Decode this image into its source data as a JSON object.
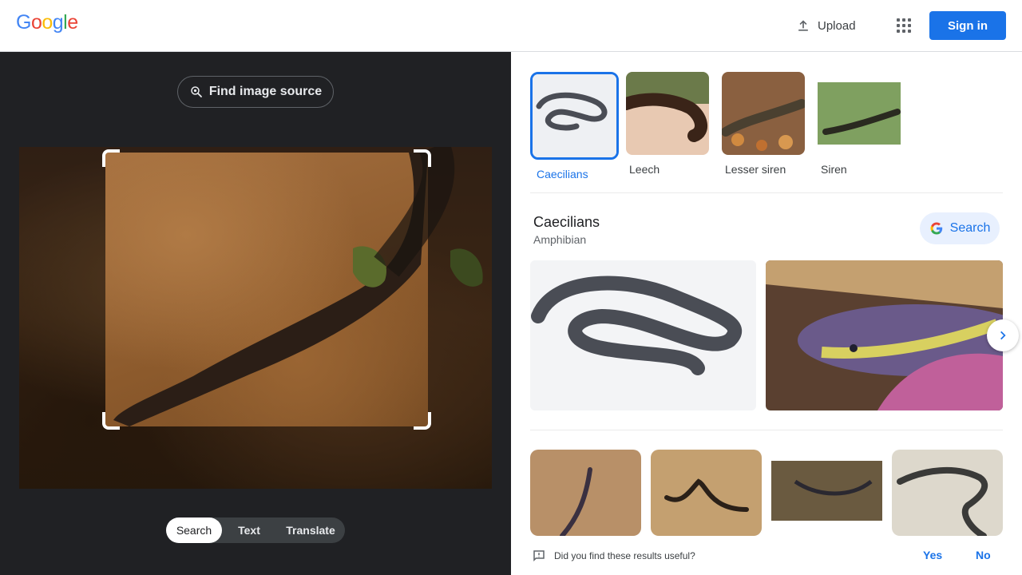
{
  "header": {
    "logo_letters": [
      {
        "ch": "G",
        "color": "#4285f4"
      },
      {
        "ch": "o",
        "color": "#ea4335"
      },
      {
        "ch": "o",
        "color": "#fbbc05"
      },
      {
        "ch": "g",
        "color": "#4285f4"
      },
      {
        "ch": "l",
        "color": "#34a853"
      },
      {
        "ch": "e",
        "color": "#ea4335"
      }
    ],
    "upload_label": "Upload",
    "signin_label": "Sign in"
  },
  "left": {
    "find_source_label": "Find image source",
    "tabs": [
      {
        "label": "Search",
        "active": true
      },
      {
        "label": "Text",
        "active": false
      },
      {
        "label": "Translate",
        "active": false
      }
    ]
  },
  "right": {
    "chips": [
      {
        "label": "Caecilians",
        "active": true
      },
      {
        "label": "Leech",
        "active": false
      },
      {
        "label": "Lesser siren",
        "active": false
      },
      {
        "label": "Siren",
        "active": false
      }
    ],
    "knowledge": {
      "title": "Caecilians",
      "subtitle": "Amphibian",
      "search_label": "Search"
    },
    "feedback": {
      "question": "Did you find these results useful?",
      "yes": "Yes",
      "no": "No"
    }
  },
  "colors": {
    "accent": "#1a73e8",
    "dark_bg": "#202124"
  }
}
